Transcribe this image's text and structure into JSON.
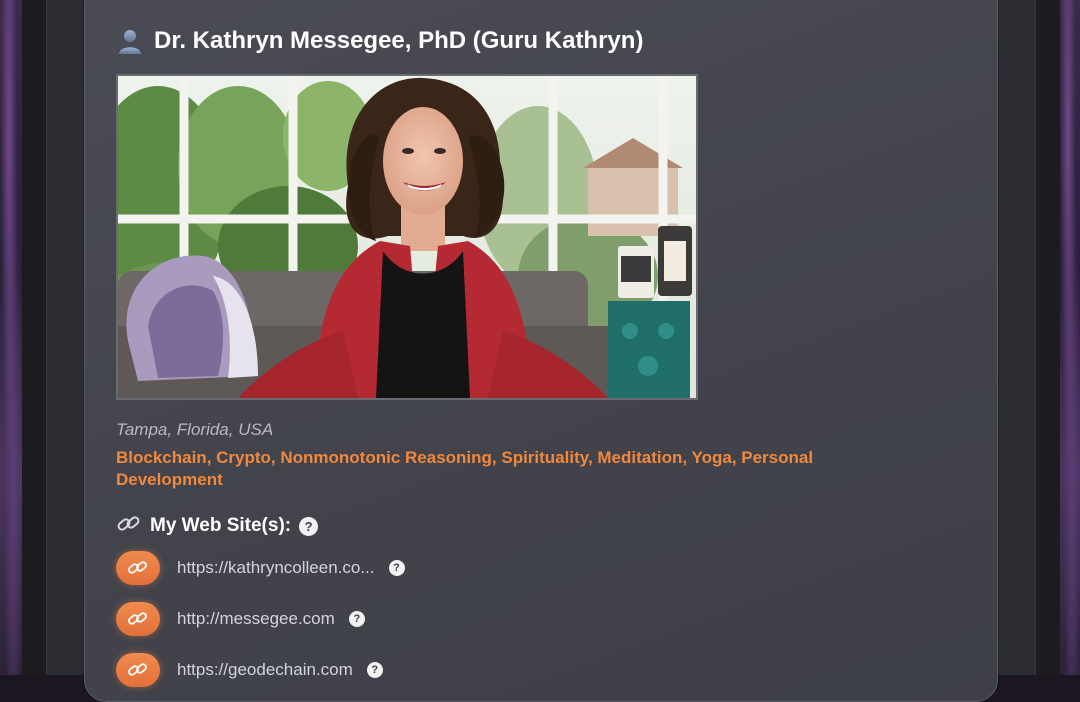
{
  "profile": {
    "name": "Dr. Kathryn Messegee, PhD (Guru Kathryn)",
    "location": "Tampa, Florida, USA",
    "interests": "Blockchain, Crypto, Nonmonotonic Reasoning, Spirituality, Meditation, Yoga, Personal Development",
    "photo_icon": "profile-photo"
  },
  "websites": {
    "title": "My Web Site(s):",
    "help_glyph": "?",
    "items": [
      {
        "url": "https://kathryncolleen.co...",
        "help_glyph": "?"
      },
      {
        "url": "http://messegee.com",
        "help_glyph": "?"
      },
      {
        "url": "https://geodechain.com",
        "help_glyph": "?"
      }
    ]
  },
  "icons": {
    "title_icon": "person-silhouette-icon",
    "section_icon": "link-icon",
    "button_icon": "link-icon"
  },
  "colors": {
    "accent": "#f0883e",
    "card_bg": "#45464e",
    "page_bg": "#2c2d32",
    "text_primary": "#ffffff",
    "text_secondary": "#b9bac0"
  }
}
